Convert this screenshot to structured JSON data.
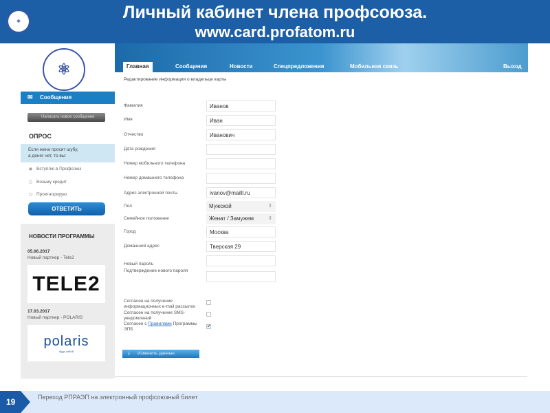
{
  "slide": {
    "title": "Личный кабинет  члена профсоюза.",
    "url": "www.card.profatom.ru",
    "number": "19",
    "footer": "Переход РПРАЭП на электронный профсоюзный билет"
  },
  "nav": {
    "tabs": [
      "Главная",
      "Сообщения",
      "Новости",
      "Спецпредложения",
      "Мобильная связь"
    ],
    "logout": "Выход"
  },
  "sidebar": {
    "messages": "Сообщения",
    "new_message": "Написать новое сообщение",
    "poll": {
      "title": "ОПРОС",
      "question_line1": "Если жена просит шубу,",
      "question_line2": "а денег нет, то вы:",
      "options": [
        "Вступлю в Профсоюз",
        "Возьму кредит",
        "Проигнорирую"
      ],
      "selected": 0,
      "answer": "ОТВЕТИТЬ"
    },
    "news": {
      "title": "НОВОСТИ ПРОГРАММЫ",
      "items": [
        {
          "date": "05.06.2017",
          "text": "Новый партнер - Tele2",
          "logo": "TELE2"
        },
        {
          "date": "17.03.2017",
          "text": "Новый партнер - POLARIS",
          "logo": "polaris",
          "logo_tagline": "будь собой"
        }
      ]
    }
  },
  "form": {
    "title": "Редактирование информации о владельце карты",
    "fields": [
      {
        "label": "Фамилия",
        "value": "Иванов"
      },
      {
        "label": "Имя",
        "value": "Иван"
      },
      {
        "label": "Отчество",
        "value": "Иванович"
      },
      {
        "label": "Дата рождения",
        "value": ""
      },
      {
        "label": "Номер мобильного телефона",
        "value": ""
      },
      {
        "label": "Номер домашнего телефона",
        "value": ""
      },
      {
        "label": "Адрес электронной почты",
        "value": "ivanov@mailll.ru"
      },
      {
        "label": "Пол",
        "value": "Мужской"
      },
      {
        "label": "Семейное положение",
        "value": "Женат / Замужем"
      },
      {
        "label": "Город",
        "value": "Москва"
      },
      {
        "label": "Домашний адрес",
        "value": "Тверская 29"
      },
      {
        "label": "Новый пароль",
        "value": ""
      },
      {
        "label": "Подтверждение нового пароля",
        "value": ""
      }
    ],
    "consents": [
      {
        "label": "Согласен на получение информационных e-mail рассылок",
        "checked": false
      },
      {
        "label": "Согласен на получение SMS-уведомлений",
        "checked": false
      },
      {
        "label_pre": "Согласен с ",
        "link": "Правилами",
        "label_post": " Программы ЭПБ",
        "checked": true
      }
    ],
    "submit": "Изменить данные"
  }
}
